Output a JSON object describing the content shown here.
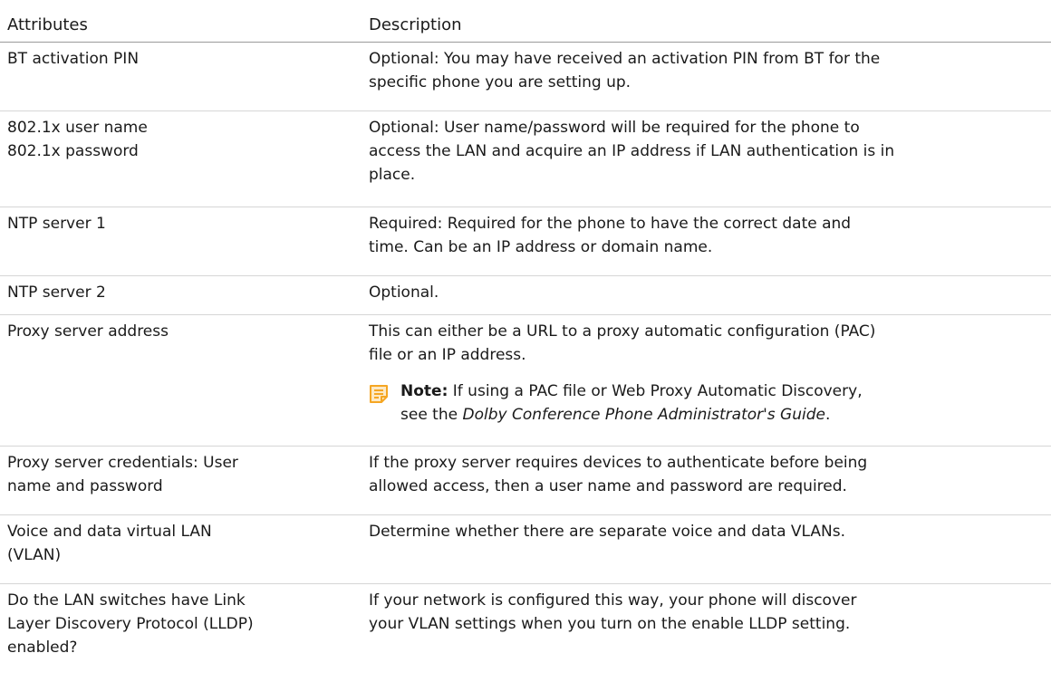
{
  "table": {
    "headers": {
      "attributes": "Attributes",
      "description": "Description"
    },
    "rows": [
      {
        "attribute_lines": [
          "BT activation PIN"
        ],
        "description_lines": [
          "Optional: You may have received an activation PIN from BT for the",
          "specific phone you are setting up."
        ]
      },
      {
        "attribute_lines": [
          "802.1x user name",
          "802.1x password"
        ],
        "description_lines": [
          "Optional: User name/password will be required for the phone to",
          "access the LAN and acquire an IP address if LAN authentication is in",
          "place."
        ]
      },
      {
        "attribute_lines": [
          "NTP server 1"
        ],
        "description_lines": [
          "Required: Required for the phone to have the correct date and",
          "time. Can be an IP address or domain name."
        ]
      },
      {
        "attribute_lines": [
          "NTP server 2"
        ],
        "description_lines": [
          "Optional."
        ]
      },
      {
        "attribute_lines": [
          "Proxy server address"
        ],
        "description_lines": [
          "This can either be a URL to a proxy automatic configuration (PAC)",
          "file or an IP address."
        ],
        "note": {
          "icon": "note-icon",
          "label": "Note:",
          "line1_rest": " If using a PAC file or Web Proxy Automatic Discovery,",
          "line2_prefix": "see the ",
          "line2_italic": "Dolby Conference Phone Administrator's Guide",
          "line2_suffix": "."
        }
      },
      {
        "attribute_lines": [
          "Proxy server credentials: User",
          "name and password"
        ],
        "description_lines": [
          "If the proxy server requires devices to authenticate before being",
          "allowed access, then a user name and password are required."
        ]
      },
      {
        "attribute_lines": [
          "Voice and data virtual LAN",
          "(VLAN)"
        ],
        "description_lines": [
          "Determine whether there are separate voice and data VLANs."
        ]
      },
      {
        "attribute_lines": [
          "Do the LAN switches have Link",
          "Layer Discovery Protocol (LLDP)",
          "enabled?"
        ],
        "description_lines": [
          "If your network is configured this way, your phone will discover",
          "your VLAN settings when you turn on the enable LLDP setting."
        ]
      }
    ]
  },
  "colors": {
    "note_icon": "#f5a623",
    "text": "#1a1a1a",
    "divider": "#d6d6d6"
  }
}
